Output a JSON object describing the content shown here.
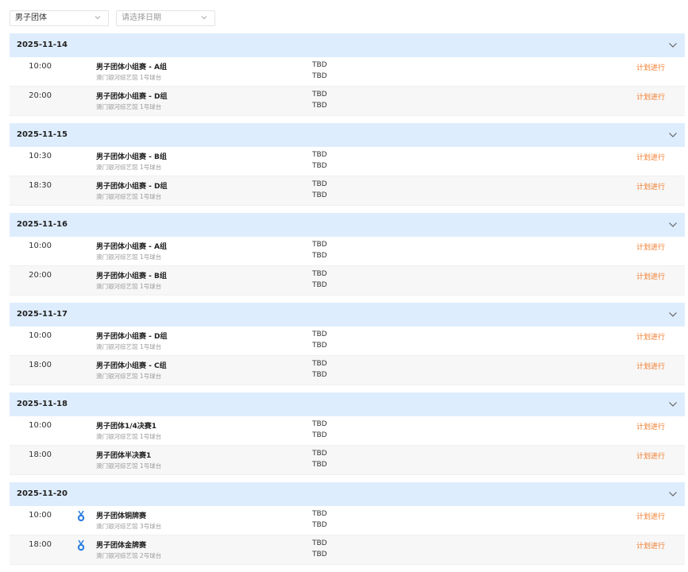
{
  "filters": {
    "event_value": "男子团体",
    "date_placeholder": "请选择日期"
  },
  "colors": {
    "header_bg": "#deedfd",
    "status": "#f07a2a",
    "medal": "#2f7fe0"
  },
  "groups": [
    {
      "date": "2025-11-14",
      "matches": [
        {
          "time": "10:00",
          "medal": false,
          "title": "男子团体小组赛 - A组",
          "venue": "澳门银河综艺馆 1号球台",
          "team1": "TBD",
          "team2": "TBD",
          "status": "计划进行"
        },
        {
          "time": "20:00",
          "medal": false,
          "title": "男子团体小组赛 - D组",
          "venue": "澳门银河综艺馆 1号球台",
          "team1": "TBD",
          "team2": "TBD",
          "status": "计划进行"
        }
      ]
    },
    {
      "date": "2025-11-15",
      "matches": [
        {
          "time": "10:30",
          "medal": false,
          "title": "男子团体小组赛 - B组",
          "venue": "澳门银河综艺馆 1号球台",
          "team1": "TBD",
          "team2": "TBD",
          "status": "计划进行"
        },
        {
          "time": "18:30",
          "medal": false,
          "title": "男子团体小组赛 - D组",
          "venue": "澳门银河综艺馆 1号球台",
          "team1": "TBD",
          "team2": "TBD",
          "status": "计划进行"
        }
      ]
    },
    {
      "date": "2025-11-16",
      "matches": [
        {
          "time": "10:00",
          "medal": false,
          "title": "男子团体小组赛 - A组",
          "venue": "澳门银河综艺馆 1号球台",
          "team1": "TBD",
          "team2": "TBD",
          "status": "计划进行"
        },
        {
          "time": "20:00",
          "medal": false,
          "title": "男子团体小组赛 - B组",
          "venue": "澳门银河综艺馆 1号球台",
          "team1": "TBD",
          "team2": "TBD",
          "status": "计划进行"
        }
      ]
    },
    {
      "date": "2025-11-17",
      "matches": [
        {
          "time": "10:00",
          "medal": false,
          "title": "男子团体小组赛 - D组",
          "venue": "澳门银河综艺馆 1号球台",
          "team1": "TBD",
          "team2": "TBD",
          "status": "计划进行"
        },
        {
          "time": "18:00",
          "medal": false,
          "title": "男子团体小组赛 - C组",
          "venue": "澳门银河综艺馆 1号球台",
          "team1": "TBD",
          "team2": "TBD",
          "status": "计划进行"
        }
      ]
    },
    {
      "date": "2025-11-18",
      "matches": [
        {
          "time": "10:00",
          "medal": false,
          "title": "男子团体1/4决赛1",
          "venue": "澳门银河综艺馆 1号球台",
          "team1": "TBD",
          "team2": "TBD",
          "status": "计划进行"
        },
        {
          "time": "18:00",
          "medal": false,
          "title": "男子团体半决赛1",
          "venue": "澳门银河综艺馆 1号球台",
          "team1": "TBD",
          "team2": "TBD",
          "status": "计划进行"
        }
      ]
    },
    {
      "date": "2025-11-20",
      "matches": [
        {
          "time": "10:00",
          "medal": true,
          "title": "男子团体铜牌赛",
          "venue": "澳门银河综艺馆 3号球台",
          "team1": "TBD",
          "team2": "TBD",
          "status": "计划进行"
        },
        {
          "time": "18:00",
          "medal": true,
          "title": "男子团体金牌赛",
          "venue": "澳门银河综艺馆 2号球台",
          "team1": "TBD",
          "team2": "TBD",
          "status": "计划进行"
        }
      ]
    }
  ]
}
